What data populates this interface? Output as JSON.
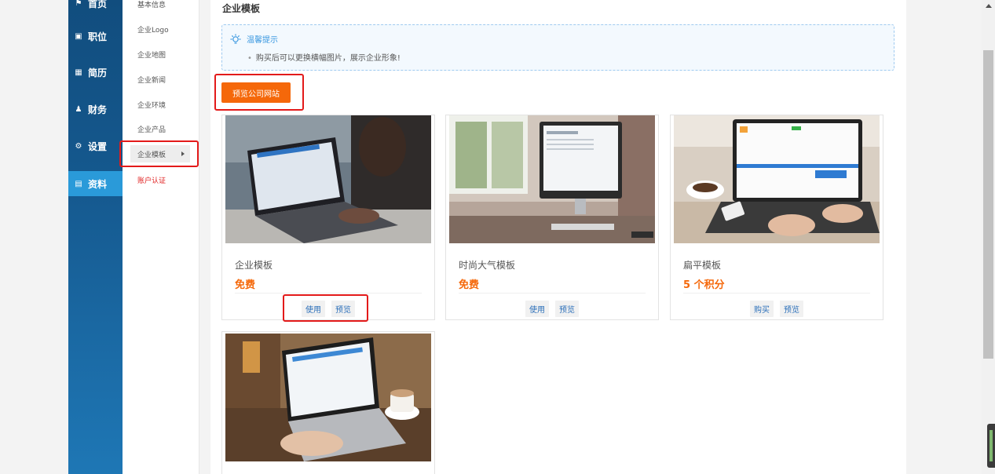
{
  "nav": {
    "items": [
      {
        "label": "首页",
        "icon": "home-icon"
      },
      {
        "label": "职位",
        "icon": "briefcase-icon"
      },
      {
        "label": "简历",
        "icon": "id-card-icon"
      },
      {
        "label": "财务",
        "icon": "users-icon"
      },
      {
        "label": "设置",
        "icon": "gear-icon"
      },
      {
        "label": "资料",
        "icon": "chart-icon"
      }
    ],
    "active": "资料"
  },
  "submenu": {
    "items": [
      "基本信息",
      "企业Logo",
      "企业地图",
      "企业新闻",
      "企业环境",
      "企业产品",
      "企业模板",
      "账户认证"
    ],
    "selected": "企业模板"
  },
  "main": {
    "title": "企业模板",
    "tip": {
      "title": "温馨提示",
      "text": "购买后可以更换横幅图片，展示企业形象!"
    },
    "preview_site_label": "预览公司网站",
    "templates": [
      {
        "name": "企业模板",
        "price": "免费",
        "action1": "使用",
        "action2": "预览"
      },
      {
        "name": "时尚大气模板",
        "price": "免费",
        "action1": "使用",
        "action2": "预览"
      },
      {
        "name": "扁平模板",
        "price": "5 个积分",
        "action1": "购买",
        "action2": "预览"
      },
      {
        "name": "",
        "price": "",
        "action1": "",
        "action2": ""
      }
    ]
  },
  "colors": {
    "accent_orange": "#f5680a",
    "nav_dark": "#114d7e",
    "nav_active": "#2a9ad9",
    "highlight_red": "#e31a1a",
    "link_blue": "#2b6fb9"
  }
}
